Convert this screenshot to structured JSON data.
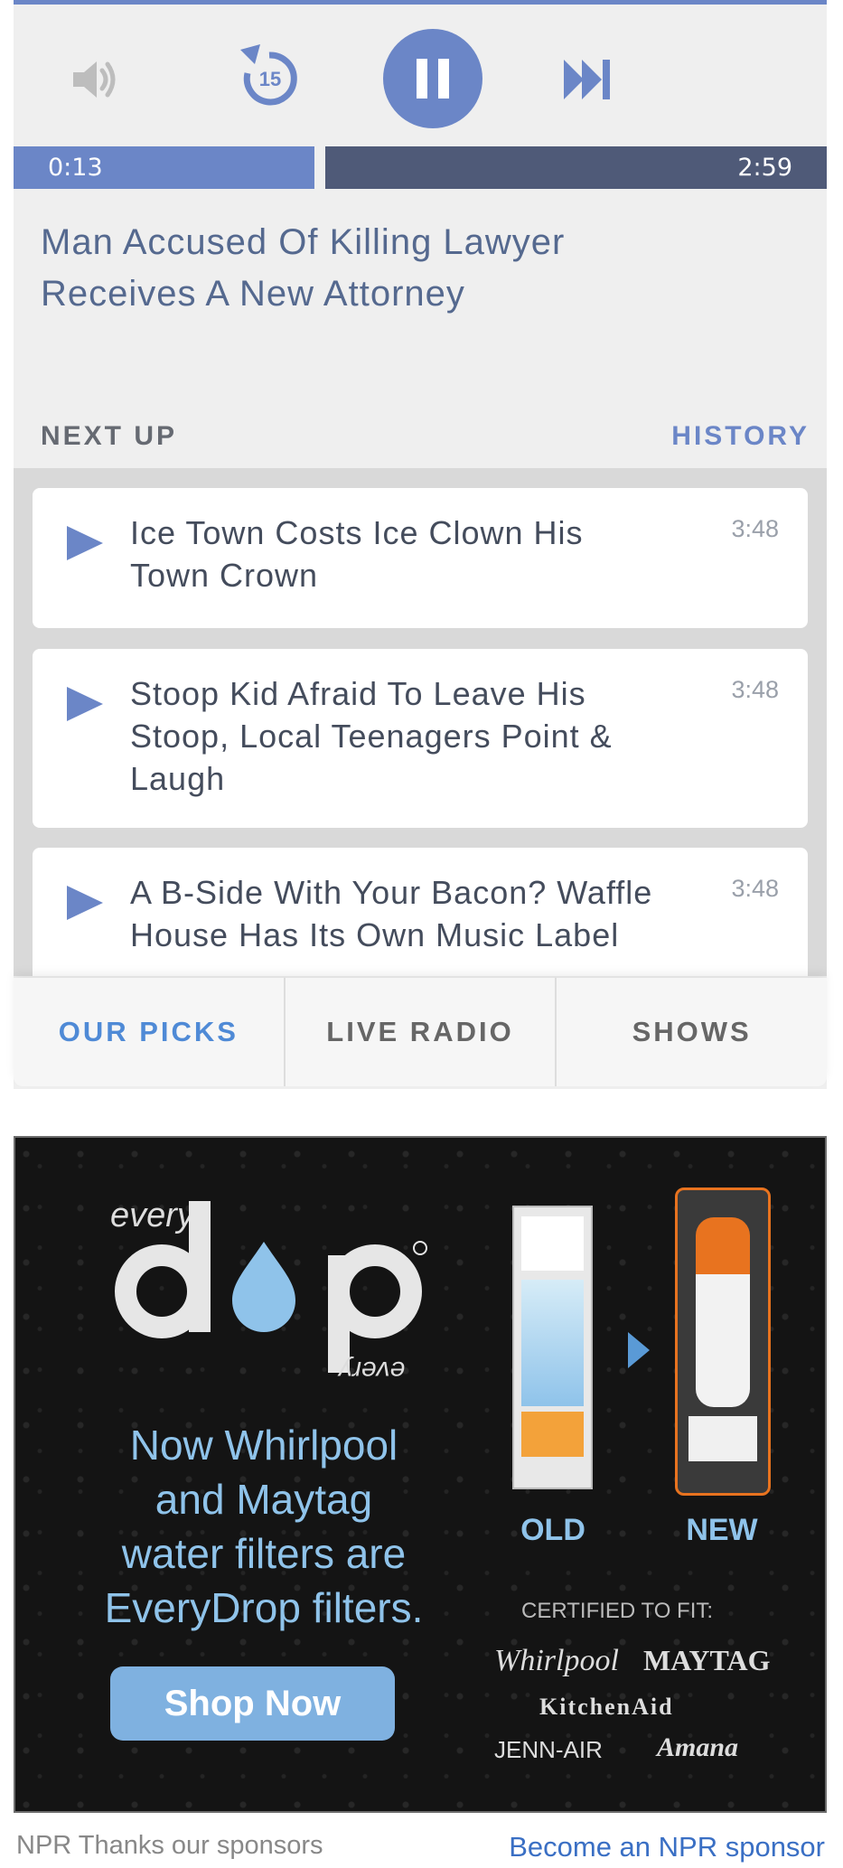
{
  "player": {
    "current_time": "0:13",
    "total_time": "2:59",
    "progress_fraction": 0.073,
    "now_playing_title": "Man Accused Of Killing Lawyer Receives A New Attorney",
    "rewind_label": "15",
    "accent_color": "#6b86c7"
  },
  "queue": {
    "next_up_label": "NEXT UP",
    "history_label": "HISTORY",
    "items": [
      {
        "title": "Ice Town Costs Ice Clown His Town Crown",
        "duration": "3:48"
      },
      {
        "title": "Stoop Kid Afraid To Leave His Stoop, Local Teenagers Point & Laugh",
        "duration": "3:48"
      },
      {
        "title": "A B-Side With Your Bacon? Waffle House Has Its Own Music Label",
        "duration": "3:48"
      }
    ]
  },
  "tabs": [
    {
      "label": "OUR PICKS",
      "active": true
    },
    {
      "label": "LIVE RADIO",
      "active": false
    },
    {
      "label": "SHOWS",
      "active": false
    }
  ],
  "ad": {
    "brand_top": "every",
    "brand_word": "drop",
    "brand_bottom": "every",
    "line1": "Now Whirlpool",
    "line2": "and Maytag",
    "line3": "water filters are",
    "line4": "EveryDrop filters.",
    "cta": "Shop Now",
    "old_label": "OLD",
    "new_label": "NEW",
    "certified_label": "CERTIFIED TO FIT:",
    "brands": [
      "Whirlpool",
      "MAYTAG",
      "KitchenAid",
      "JENN-AIR",
      "Amana"
    ]
  },
  "footer": {
    "left": "NPR Thanks our sponsors",
    "right": "Become an NPR sponsor"
  }
}
